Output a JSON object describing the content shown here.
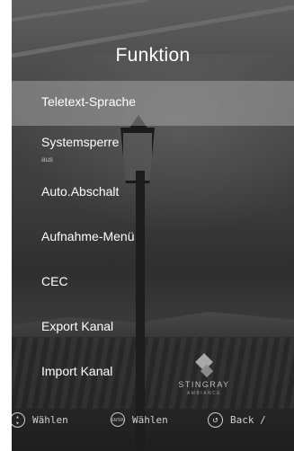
{
  "title": "Funktion",
  "menu": {
    "items": [
      {
        "label": "Teletext-Sprache",
        "sub": ""
      },
      {
        "label": "Systemsperre",
        "sub": "aus"
      },
      {
        "label": "Auto.Abschalt",
        "sub": ""
      },
      {
        "label": "Aufnahme-Menü",
        "sub": ""
      },
      {
        "label": "CEC",
        "sub": ""
      },
      {
        "label": "Export Kanal",
        "sub": ""
      },
      {
        "label": "Import Kanal",
        "sub": ""
      }
    ],
    "selected_index": 0
  },
  "logo": {
    "brand": "STINGRAY",
    "sub_brand": "AMBIANCE"
  },
  "footer": {
    "nav": {
      "icon": "up-down-navigation-icon",
      "label": "Wählen"
    },
    "enter": {
      "icon": "enter-button-icon",
      "icon_text": "ENTER",
      "label": "Wählen"
    },
    "back": {
      "icon": "back-arrow-icon",
      "label": "Back /"
    }
  },
  "colors": {
    "selected_highlight": "#c8c8c8",
    "text": "#ffffff",
    "footer_text": "#d0d0d0"
  }
}
